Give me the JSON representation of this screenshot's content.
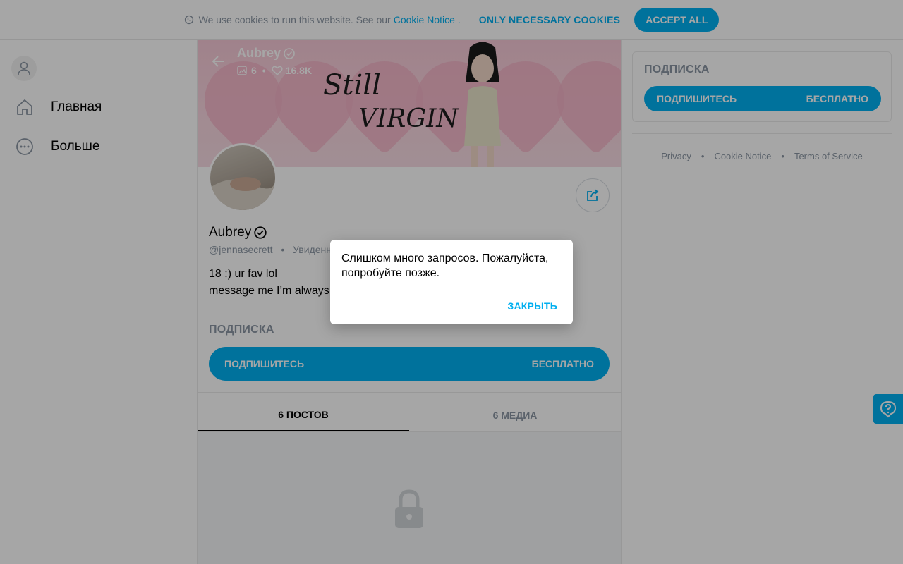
{
  "cookie_bar": {
    "text": "We use cookies to run this website. See our",
    "link": "Cookie Notice",
    "link_suffix": ".",
    "necessary_label": "ONLY NECESSARY COOKIES",
    "accept_label": "ACCEPT ALL"
  },
  "nav": {
    "items": [
      {
        "label": "Главная",
        "icon": "home-icon"
      },
      {
        "label": "Больше",
        "icon": "more-icon"
      }
    ]
  },
  "profile": {
    "name": "Aubrey",
    "posts_count": "6",
    "likes_count": "16.8K",
    "banner_text_line1": "Still",
    "banner_text_line2": "VIRGIN",
    "handle": "@jennasecrett",
    "handle_sep": "•",
    "last_seen": "Увиденно",
    "bio_line1": "18 :) ur fav lol",
    "bio_line2": "message me I’m always"
  },
  "subscription": {
    "title": "ПОДПИСКА",
    "button_left": "ПОДПИШИТЕСЬ",
    "button_right": "БЕСПЛАТНО"
  },
  "tabs": [
    {
      "label": "6 ПОСТОВ",
      "active": true
    },
    {
      "label": "6 МЕДИА",
      "active": false
    }
  ],
  "right_panel": {
    "title": "ПОДПИСКА",
    "button_left": "ПОДПИШИТЕСЬ",
    "button_right": "БЕСПЛАТНО",
    "footer": [
      "Privacy",
      "Cookie Notice",
      "Terms of Service"
    ],
    "footer_sep": "•"
  },
  "modal": {
    "message": "Слишком много запросов. Пожалуйста, попробуйте позже.",
    "close_label": "ЗАКРЫТЬ"
  },
  "colors": {
    "accent": "#00aff0",
    "muted": "#8a96a3",
    "overlay": "rgba(0,0,0,0.35)"
  }
}
